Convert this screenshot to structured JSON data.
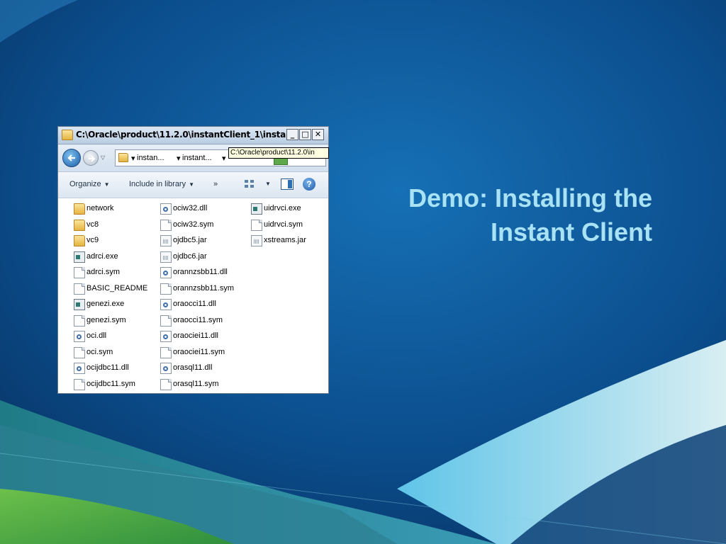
{
  "slide": {
    "title_line1": "Demo: Installing the",
    "title_line2": "Instant Client",
    "title_color": "#a9e2f5"
  },
  "window": {
    "title": "C:\\Oracle\\product\\11.2.0\\instantClient_1\\insta...",
    "controls": {
      "minimize": "_",
      "maximize": "□",
      "close": "✕"
    },
    "address": {
      "breadcrumbs": [
        "instan...",
        "instant..."
      ],
      "tooltip": "C:\\Oracle\\product\\11.2.0\\in"
    },
    "toolbar": {
      "organize": "Organize",
      "include_in_library": "Include in library",
      "more": "»",
      "help": "?"
    },
    "files": [
      {
        "name": "network",
        "type": "folder"
      },
      {
        "name": "vc8",
        "type": "folder"
      },
      {
        "name": "vc9",
        "type": "folder"
      },
      {
        "name": "adrci.exe",
        "type": "exe"
      },
      {
        "name": "adrci.sym",
        "type": "file"
      },
      {
        "name": "BASIC_README",
        "type": "file"
      },
      {
        "name": "genezi.exe",
        "type": "exe"
      },
      {
        "name": "genezi.sym",
        "type": "file"
      },
      {
        "name": "oci.dll",
        "type": "dll"
      },
      {
        "name": "oci.sym",
        "type": "file"
      },
      {
        "name": "ocijdbc11.dll",
        "type": "dll"
      },
      {
        "name": "ocijdbc11.sym",
        "type": "file"
      },
      {
        "name": "ociw32.dll",
        "type": "dll"
      },
      {
        "name": "ociw32.sym",
        "type": "file"
      },
      {
        "name": "ojdbc5.jar",
        "type": "jar"
      },
      {
        "name": "ojdbc6.jar",
        "type": "jar"
      },
      {
        "name": "orannzsbb11.dll",
        "type": "dll"
      },
      {
        "name": "orannzsbb11.sym",
        "type": "file"
      },
      {
        "name": "oraocci11.dll",
        "type": "dll"
      },
      {
        "name": "oraocci11.sym",
        "type": "file"
      },
      {
        "name": "oraociei11.dll",
        "type": "dll"
      },
      {
        "name": "oraociei11.sym",
        "type": "file"
      },
      {
        "name": "orasql11.dll",
        "type": "dll"
      },
      {
        "name": "orasql11.sym",
        "type": "file"
      },
      {
        "name": "uidrvci.exe",
        "type": "exe"
      },
      {
        "name": "uidrvci.sym",
        "type": "file"
      },
      {
        "name": "xstreams.jar",
        "type": "jar"
      }
    ]
  }
}
